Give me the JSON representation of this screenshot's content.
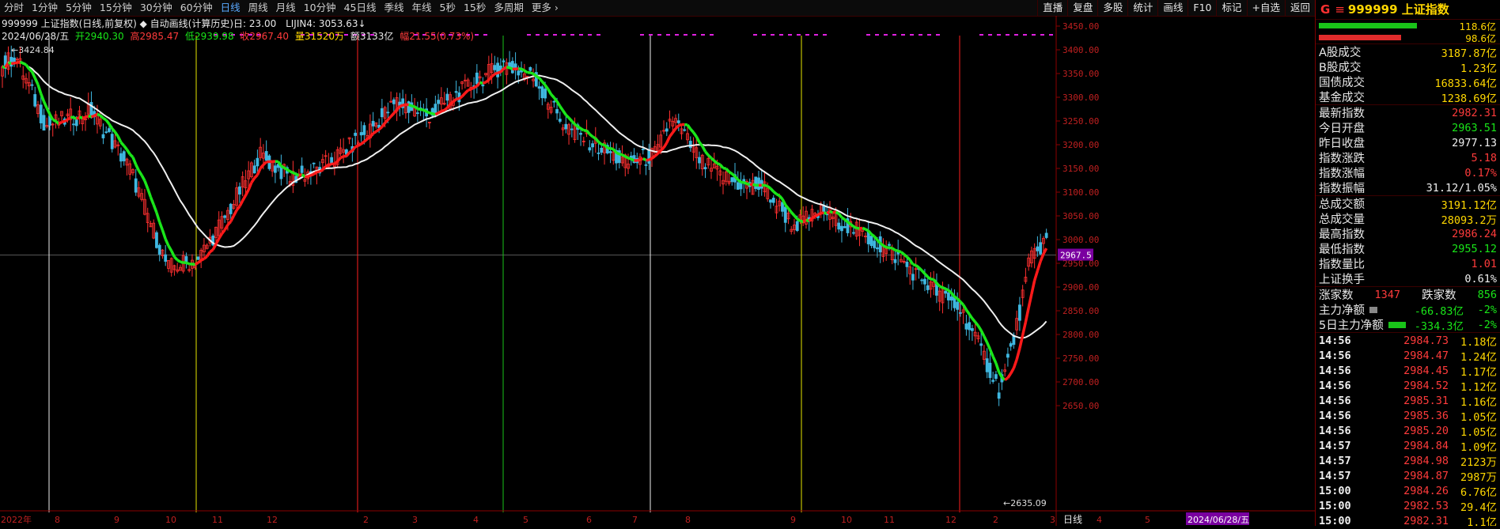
{
  "toolbar": {
    "periods": [
      "分时",
      "1分钟",
      "5分钟",
      "15分钟",
      "30分钟",
      "60分钟",
      "日线",
      "周线",
      "月线",
      "10分钟",
      "45日线",
      "季线",
      "年线",
      "5秒",
      "15秒",
      "多周期",
      "更多 ›"
    ],
    "active_period": "日线",
    "right_tools": [
      "直播",
      "复盘",
      "多股",
      "统计",
      "画线",
      "F10",
      "标记",
      "+自选",
      "返回"
    ]
  },
  "info": {
    "line1": "999999 上证指数(日线,前复权) ◆ 自动画线(计算历史)日: 23.00",
    "lijin": "LIJIN4: 3053.63↓",
    "date": "2024/06/28/五",
    "open": "开2940.30",
    "high": "高2985.47",
    "low": "低2939.98",
    "close": "收2967.40",
    "volume": "量31520万",
    "amount": "额3133亿",
    "change": "幅21.55(0.73%)"
  },
  "chart_data": {
    "type": "candlestick",
    "symbol": "999999 上证指数",
    "ylim": [
      2620,
      3470
    ],
    "y_ticks": [
      3450,
      3400,
      3350,
      3300,
      3250,
      3200,
      3150,
      3100,
      3050,
      3000,
      2950,
      2900,
      2850,
      2800,
      2750,
      2700,
      2650
    ],
    "high_mark": "3424.84",
    "low_mark": "2635.09",
    "current_price": "2967.5",
    "x_labels": [
      "2022年",
      "8",
      "9",
      "10",
      "11",
      "12",
      "2",
      "3",
      "4",
      "5",
      "6",
      "7",
      "8",
      "9",
      "10",
      "11",
      "12",
      "2",
      "3",
      "4",
      "5",
      "2024/06/28/五"
    ],
    "ma_line": "white",
    "trend_line": "red-green",
    "bottom_right_label": "日线"
  },
  "side": {
    "g_label": "G",
    "eq": "≡",
    "code": "999999",
    "name": "上证指数",
    "ratio_up": "118.6亿",
    "ratio_down": "98.6亿",
    "stats": [
      {
        "label": "A股成交",
        "value": "3187.87亿",
        "color": "yellow"
      },
      {
        "label": "B股成交",
        "value": "1.23亿",
        "color": "yellow"
      },
      {
        "label": "国债成交",
        "value": "16833.64亿",
        "color": "yellow"
      },
      {
        "label": "基金成交",
        "value": "1238.69亿",
        "color": "yellow"
      },
      {
        "label": "最新指数",
        "value": "2982.31",
        "color": "red"
      },
      {
        "label": "今日开盘",
        "value": "2963.51",
        "color": "green"
      },
      {
        "label": "昨日收盘",
        "value": "2977.13",
        "color": "white"
      },
      {
        "label": "指数涨跌",
        "value": "5.18",
        "color": "red"
      },
      {
        "label": "指数涨幅",
        "value": "0.17%",
        "color": "red"
      },
      {
        "label": "指数振幅",
        "value": "31.12/1.05%",
        "color": "white"
      },
      {
        "label": "总成交额",
        "value": "3191.12亿",
        "color": "yellow"
      },
      {
        "label": "总成交量",
        "value": "28093.2万",
        "color": "yellow"
      },
      {
        "label": "最高指数",
        "value": "2986.24",
        "color": "red"
      },
      {
        "label": "最低指数",
        "value": "2955.12",
        "color": "green"
      },
      {
        "label": "指数量比",
        "value": "1.01",
        "color": "red"
      },
      {
        "label": "上证换手",
        "value": "0.61%",
        "color": "white"
      }
    ],
    "updown": {
      "up_label": "涨家数",
      "up_value": "1347",
      "down_label": "跌家数",
      "down_value": "856"
    },
    "flow": [
      {
        "label": "主力净额",
        "value": "-66.83亿",
        "pct": "-2%"
      },
      {
        "label": "5日主力净额",
        "value": "-334.3亿",
        "pct": "-2%"
      }
    ],
    "ticks": [
      {
        "time": "14:56",
        "price": "2984.73",
        "vol": "1.18亿"
      },
      {
        "time": "14:56",
        "price": "2984.47",
        "vol": "1.24亿"
      },
      {
        "time": "14:56",
        "price": "2984.45",
        "vol": "1.17亿"
      },
      {
        "time": "14:56",
        "price": "2984.52",
        "vol": "1.12亿"
      },
      {
        "time": "14:56",
        "price": "2985.31",
        "vol": "1.16亿"
      },
      {
        "time": "14:56",
        "price": "2985.36",
        "vol": "1.05亿"
      },
      {
        "time": "14:56",
        "price": "2985.20",
        "vol": "1.05亿"
      },
      {
        "time": "14:57",
        "price": "2984.84",
        "vol": "1.09亿"
      },
      {
        "time": "14:57",
        "price": "2984.98",
        "vol": "2123万"
      },
      {
        "time": "14:57",
        "price": "2984.87",
        "vol": "2987万"
      },
      {
        "time": "15:00",
        "price": "2984.26",
        "vol": "6.76亿"
      },
      {
        "time": "15:00",
        "price": "2982.53",
        "vol": "29.4亿"
      },
      {
        "time": "15:00",
        "price": "2982.31",
        "vol": "1.1亿"
      }
    ]
  }
}
